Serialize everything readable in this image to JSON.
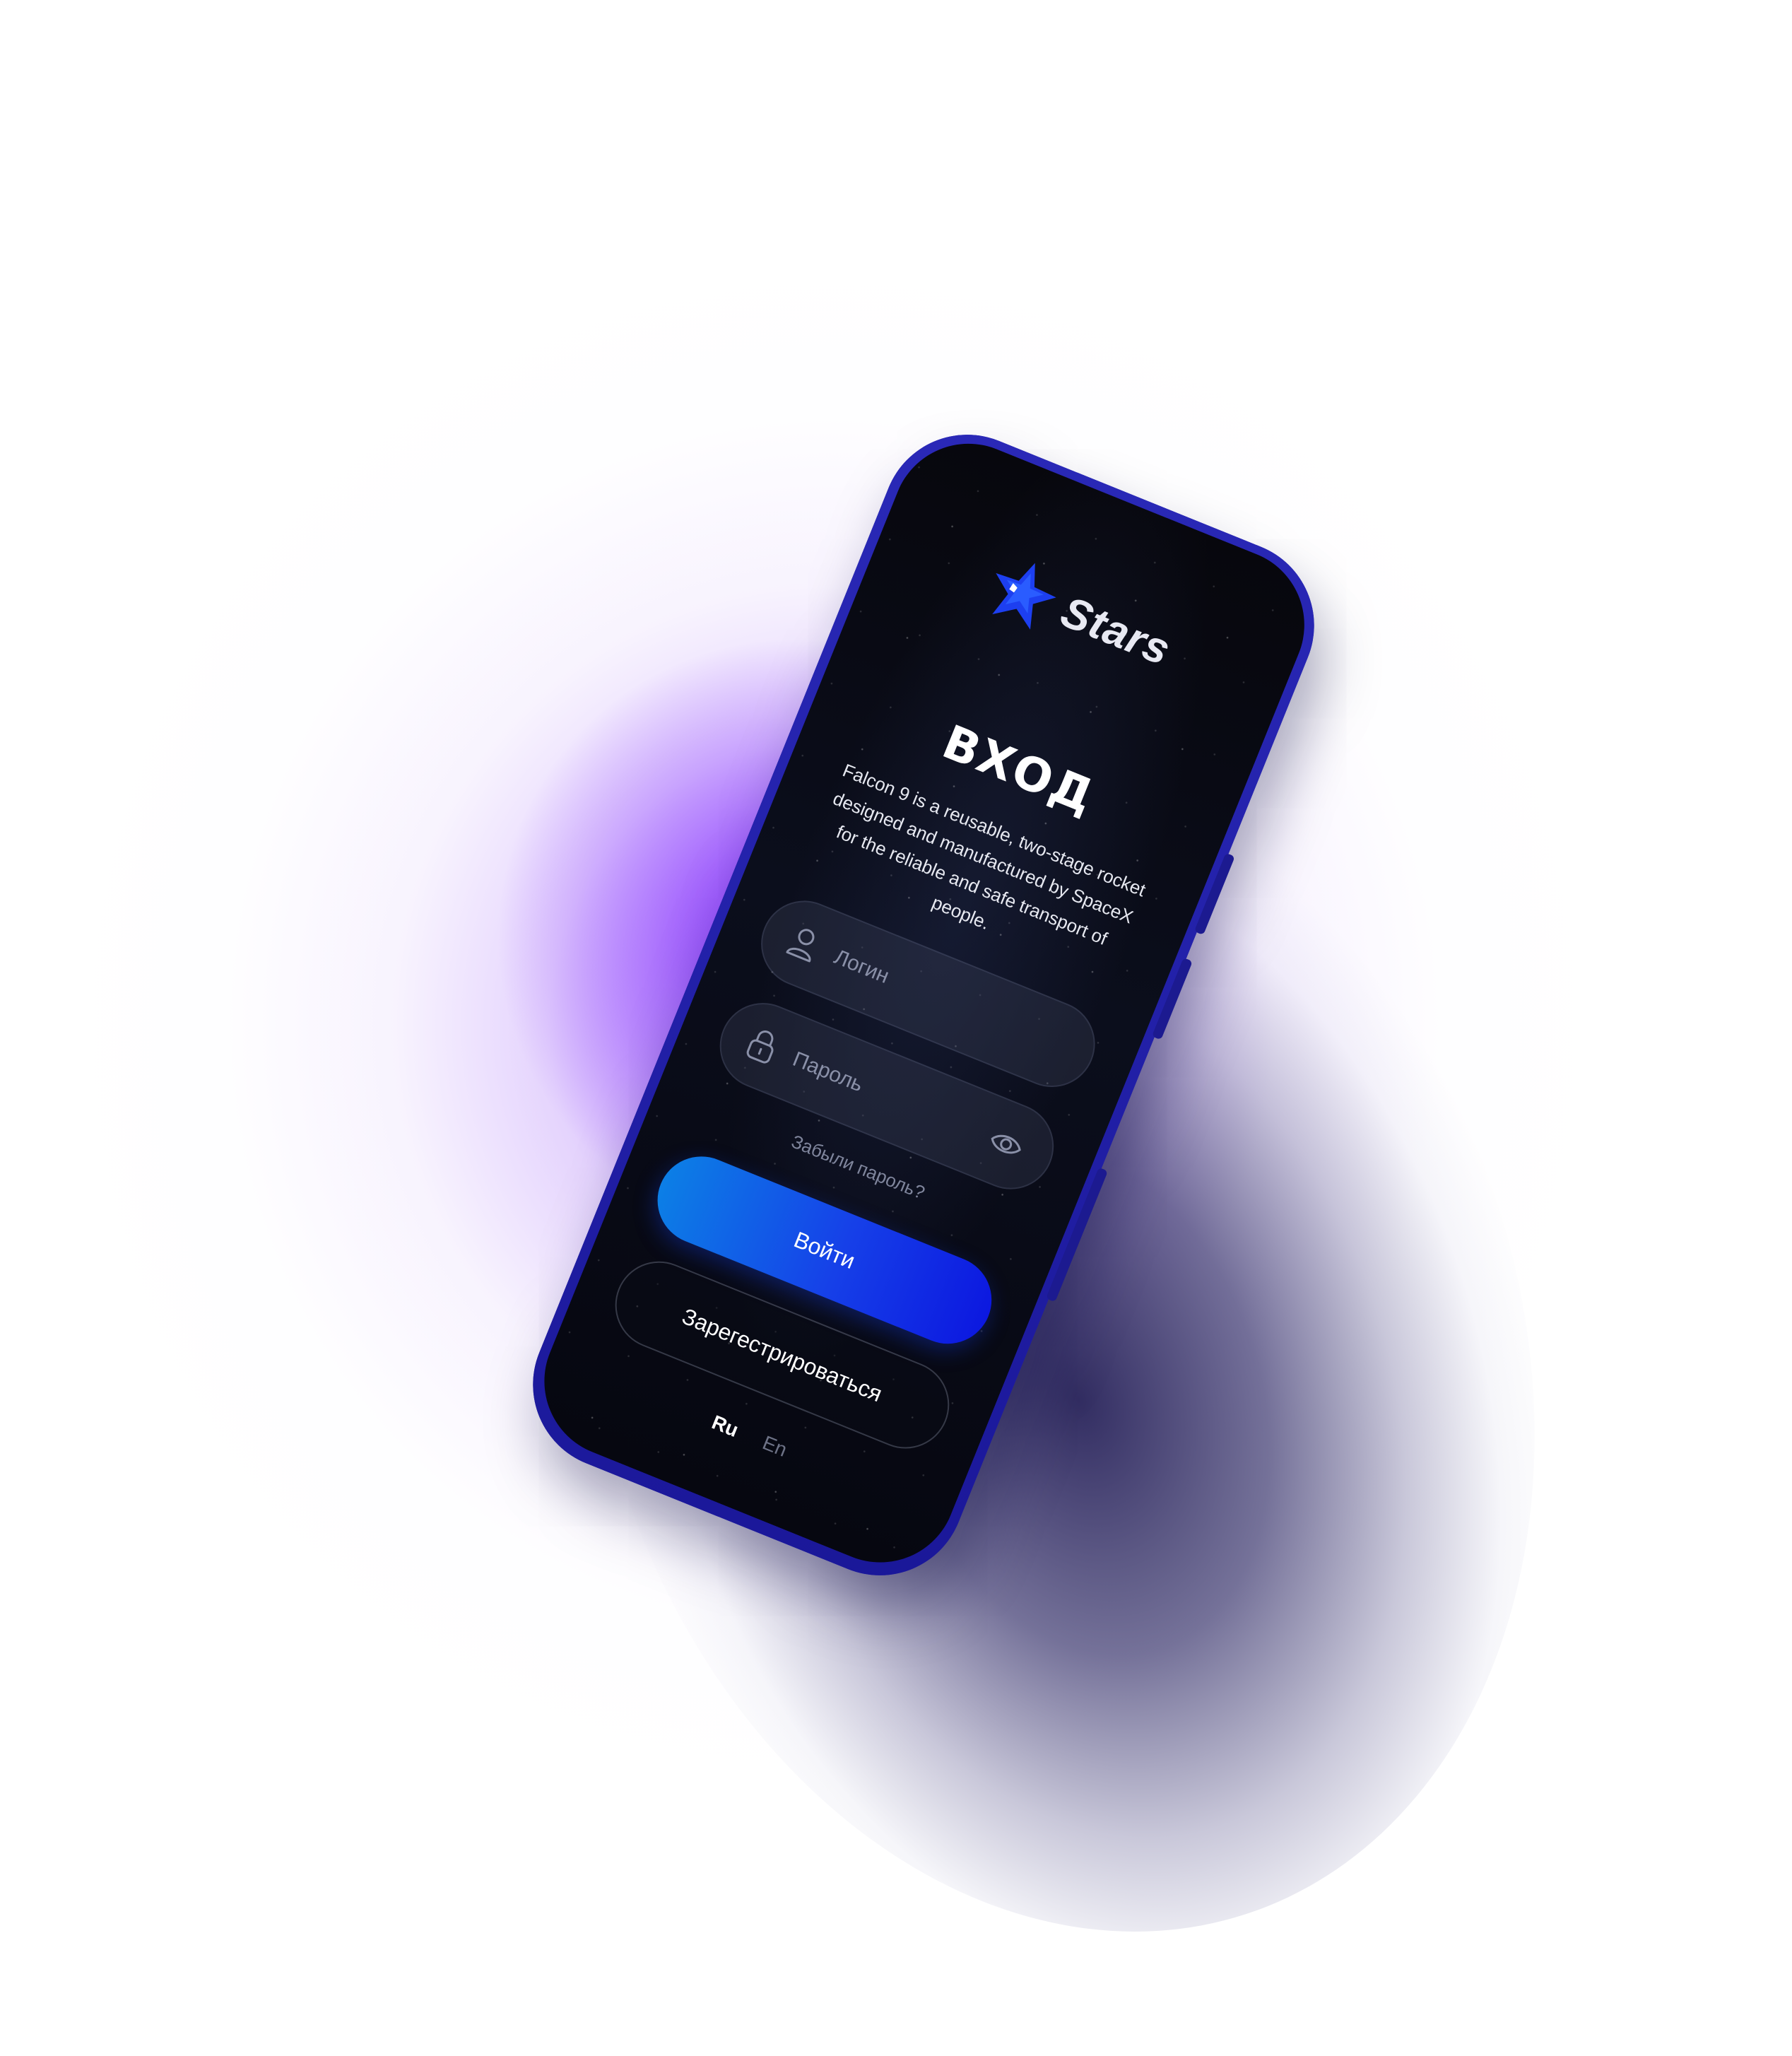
{
  "brand": {
    "name": "Stars",
    "logo_icon": "star-logo-icon",
    "accent_color": "#1c3fe6"
  },
  "login": {
    "title": "ВХОД",
    "description": "Falcon 9 is a reusable, two-stage rocket designed and manufactured by SpaceX for the reliable and safe transport of people.",
    "fields": {
      "login_placeholder": "Логин",
      "login_icon": "user-icon",
      "password_placeholder": "Пароль",
      "password_icon": "lock-icon",
      "password_toggle_icon": "eye-icon"
    },
    "forgot_password": "Забыли пароль?",
    "submit_label": "Войти",
    "register_label": "Зарегестрироваться"
  },
  "language": {
    "options": [
      "Ru",
      "En"
    ],
    "selected": "Ru"
  },
  "colors": {
    "phone_frame": "#2220a8",
    "screen_background": "#07070d",
    "glow": "#9a4dff",
    "button_gradient_start": "#0c7fe6",
    "button_gradient_end": "#0c18e0"
  }
}
